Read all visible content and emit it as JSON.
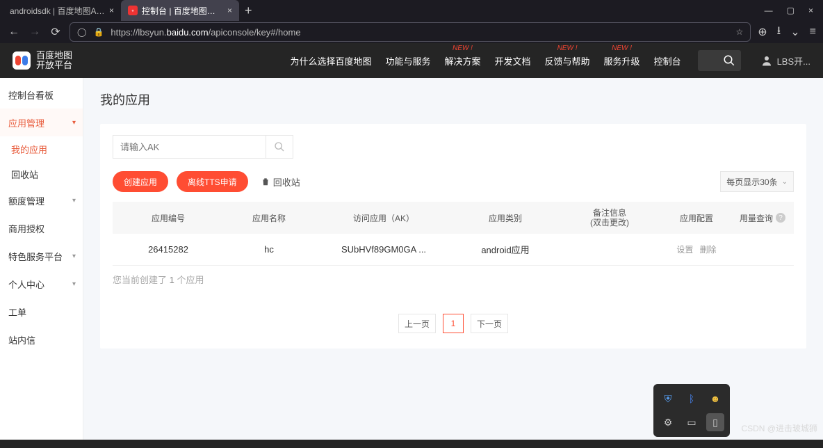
{
  "browser": {
    "tabs": [
      {
        "title": "androidsdk | 百度地图API SDK"
      },
      {
        "title": "控制台 | 百度地图开放平台"
      }
    ],
    "url_prefix": "https://lbsyun.",
    "url_domain": "baidu.com",
    "url_path": "/apiconsole/key#/home"
  },
  "header": {
    "logo_line1": "百度地图",
    "logo_line2": "开放平台",
    "nav": {
      "why": "为什么选择百度地图",
      "features": "功能与服务",
      "solutions": "解决方案",
      "docs": "开发文档",
      "feedback": "反馈与帮助",
      "upgrade": "服务升级",
      "console": "控制台"
    },
    "badge": "NEW !",
    "user": "LBS开..."
  },
  "sidebar": {
    "dashboard": "控制台看板",
    "app_mgmt": "应用管理",
    "my_apps": "我的应用",
    "trash": "回收站",
    "quota": "额度管理",
    "auth": "商用授权",
    "special": "特色服务平台",
    "personal": "个人中心",
    "tickets": "工单",
    "inbox": "站内信"
  },
  "main": {
    "title": "我的应用",
    "search_placeholder": "请输入AK",
    "btn_create": "创建应用",
    "btn_tts": "离线TTS申请",
    "link_trash": "回收站",
    "page_size": "每页显示30条",
    "cols": {
      "id": "应用编号",
      "name": "应用名称",
      "ak": "访问应用（AK）",
      "type": "应用类别",
      "note_l1": "备注信息",
      "note_l2": "(双击更改)",
      "config": "应用配置",
      "usage": "用量查询"
    },
    "row": {
      "id": "26415282",
      "name": "hc",
      "ak": "SUbHVf89GM0GA  ...",
      "type": "android应用",
      "action_set": "设置",
      "action_del": "删除"
    },
    "summary_prefix": "您当前创建了 ",
    "summary_count": "1",
    "summary_suffix": " 个应用",
    "prev": "上一页",
    "page": "1",
    "next": "下一页"
  },
  "watermark": "CSDN @进击玻城狮"
}
